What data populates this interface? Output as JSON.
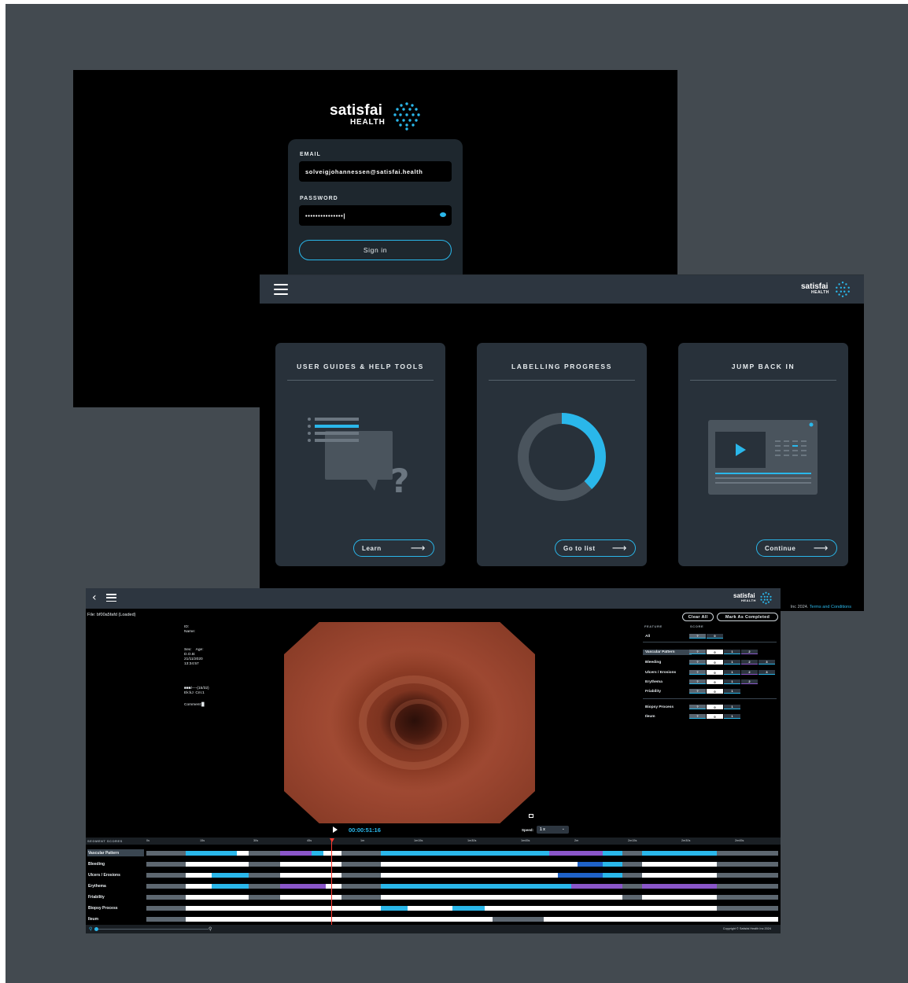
{
  "brand": {
    "name": "satisfai",
    "sub": "HEALTH",
    "accent": "#2ab7ea",
    "purple": "#8a56c9"
  },
  "login": {
    "email_label": "EMAIL",
    "email_value": "solveigjohannessen@satisfai.health",
    "password_label": "PASSWORD",
    "password_value": "•••••••••••••••|",
    "signin_label": "Sign in"
  },
  "dashboard": {
    "cards": [
      {
        "title": "USER GUIDES & HELP TOOLS",
        "button": "Learn"
      },
      {
        "title": "LABELLING PROGRESS",
        "button": "Go to list",
        "progress_fraction": 0.38
      },
      {
        "title": "JUMP BACK IN",
        "button": "Continue"
      }
    ],
    "footer_text": "Inc 2024.",
    "footer_link": "Terms and Conditions"
  },
  "annotator": {
    "file": "File: bf00a5fafd (Loaded)",
    "meta": {
      "id_block": "ID:\nName:",
      "sex_block": "Sex:    Age:\nD.O.B:\n21/11/2020\n13:34:57",
      "code_block": "■■■/----(15/32)\nEk:kJ  Cm:1",
      "comment": "Comment:█"
    },
    "clear_all": "Clear All",
    "mark_completed": "Mark As Completed",
    "score_head_feature": "FEATURE",
    "score_head_score": "SCORE",
    "score_rows": [
      {
        "label": "All",
        "boxes": [
          "?",
          "0"
        ]
      },
      {
        "label": "Vascular Pattern",
        "boxes": [
          "?",
          "0",
          "1",
          "2"
        ],
        "selected": true
      },
      {
        "label": "Bleeding",
        "boxes": [
          "?",
          "0",
          "1",
          "2",
          "3"
        ]
      },
      {
        "label": "Ulcers / Erosions",
        "boxes": [
          "?",
          "0",
          "1",
          "2",
          "3"
        ]
      },
      {
        "label": "Erythema",
        "boxes": [
          "?",
          "0",
          "1",
          "2"
        ]
      },
      {
        "label": "Friability",
        "boxes": [
          "?",
          "0",
          "1"
        ]
      },
      {
        "label": "Biopsy Process",
        "boxes": [
          "?",
          "0",
          "1"
        ]
      },
      {
        "label": "Ileum",
        "boxes": [
          "?",
          "0",
          "1"
        ]
      }
    ],
    "timecode": "00:00:51:16",
    "speed_label": "Speed:",
    "speed_value": "1 x",
    "timeline_header": "SEGMENT SCORES",
    "ticks": [
      "0s",
      "15s",
      "30s",
      "45s",
      "1m",
      "1m15s",
      "1m30s",
      "1m45s",
      "2m",
      "2m15s",
      "2m30s",
      "2m45s"
    ],
    "tracks": [
      {
        "label": "Vascular Pattern",
        "selected": true
      },
      {
        "label": "Bleeding"
      },
      {
        "label": "Ulcers / Erosions"
      },
      {
        "label": "Erythema"
      },
      {
        "label": "Friability"
      },
      {
        "label": "Biopsy Process"
      },
      {
        "label": "Ileum"
      }
    ],
    "copyright": "Copyright © Satisfai Health Inc 2024"
  }
}
